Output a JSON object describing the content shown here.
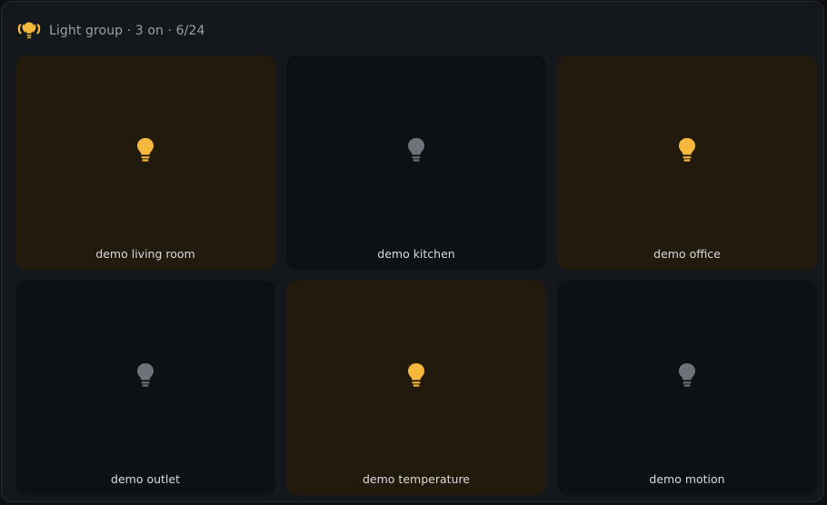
{
  "header": {
    "title": "Light group · 3 on · 6/24",
    "icon": "light-group-icon"
  },
  "colors": {
    "on": "#f6b93b",
    "off": "#6e727b",
    "tile_on_bg": "#221a0d",
    "tile_off_bg": "#0c1213"
  },
  "lights": [
    {
      "name": "demo living room",
      "on": true
    },
    {
      "name": "demo kitchen",
      "on": false
    },
    {
      "name": "demo office",
      "on": true
    },
    {
      "name": "demo outlet",
      "on": false
    },
    {
      "name": "demo temperature",
      "on": true
    },
    {
      "name": "demo motion",
      "on": false
    }
  ]
}
